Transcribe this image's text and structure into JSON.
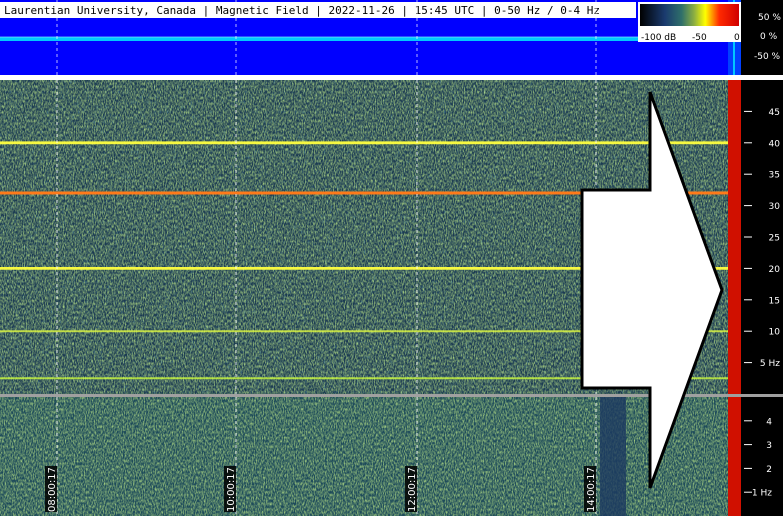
{
  "header": {
    "title": "Laurentian University, Canada | Magnetic Field | 2022-11-26 | 15:45 UTC | 0-50 Hz / 0-4 Hz"
  },
  "colorbar": {
    "labels": [
      "-100 dB",
      "-50",
      "0"
    ],
    "colors": [
      "#000000",
      "#1a3a6e",
      "#2f6f6a",
      "#8fb040",
      "#ffff00",
      "#ff2a00",
      "#d00000"
    ]
  },
  "amplitude_scale": {
    "labels": [
      "50 %",
      "0 %",
      "-50 %"
    ]
  },
  "colors": {
    "strip_background": "#0000ff",
    "trace": "#00c8ff",
    "spectrogram_base": "#1b3a52",
    "axis_background": "#000000",
    "axis_text": "#ffffff",
    "divider": "#ffffff",
    "arrow_fill": "#ffffff",
    "arrow_stroke": "#000000"
  },
  "chart_data": [
    {
      "type": "heatmap",
      "name_printed": "",
      "y_unit": "Hz",
      "ylim": [
        0,
        50
      ],
      "yticks": [
        5,
        10,
        15,
        20,
        25,
        30,
        35,
        40,
        45
      ],
      "ytick_labels": [
        "5 Hz",
        "10",
        "15",
        "20",
        "25",
        "30",
        "35",
        "40",
        "45"
      ],
      "x_tick_labels": [
        "08:00:17",
        "10:00:17",
        "12:00:17",
        "14:00:17"
      ],
      "horizontal_bands_hz": [
        {
          "freq": 40,
          "color": "#ffff40",
          "strength": 0.9
        },
        {
          "freq": 32,
          "color": "#ff7a1a",
          "strength": 1.0
        },
        {
          "freq": 20,
          "color": "#ffff40",
          "strength": 0.9
        },
        {
          "freq": 10,
          "color": "#e6ff40",
          "strength": 0.5
        },
        {
          "freq": 2.5,
          "color": "#d0ff40",
          "strength": 0.5
        }
      ],
      "grid": true
    },
    {
      "type": "heatmap",
      "name_printed": "",
      "y_unit": "Hz",
      "ylim": [
        0,
        5
      ],
      "yticks": [
        1,
        2,
        3,
        4
      ],
      "ytick_labels": [
        "1 Hz",
        "2",
        "3",
        "4"
      ],
      "grid": true
    }
  ],
  "annotation": {
    "shape": "arrow-right",
    "fill": "#ffffff"
  }
}
